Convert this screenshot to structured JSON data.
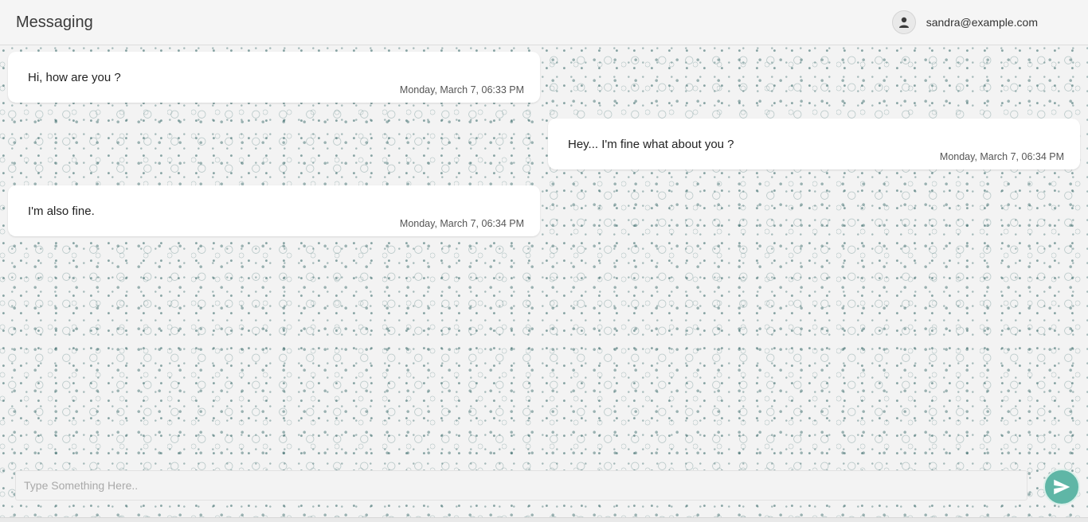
{
  "header": {
    "title": "Messaging",
    "user_email": "sandra@example.com",
    "avatar_icon": "person-icon"
  },
  "messages": [
    {
      "text": "Hi, how are you ?",
      "time": "Monday, March 7, 06:33 PM",
      "side": "left"
    },
    {
      "text": "Hey... I'm fine what about you ?",
      "time": "Monday, March 7, 06:34 PM",
      "side": "right"
    },
    {
      "text": "I'm also fine.",
      "time": "Monday, March 7, 06:34 PM",
      "side": "left"
    }
  ],
  "composer": {
    "placeholder": "Type Something Here..",
    "value": "",
    "send_icon": "send-icon"
  },
  "colors": {
    "accent": "#5fb6a6",
    "pattern": "#2f6262",
    "bubble": "#ffffff"
  }
}
